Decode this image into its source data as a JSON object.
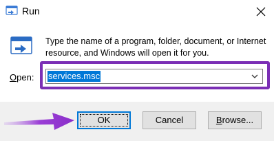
{
  "window": {
    "title": "Run"
  },
  "content": {
    "description_line1": "Type the name of a program, folder, document, or Internet",
    "description_line2": "resource, and Windows will open it for you."
  },
  "open": {
    "label_acc": "O",
    "label_rest": "pen:",
    "value": "services.msc"
  },
  "buttons": {
    "ok": "OK",
    "cancel": "Cancel",
    "browse_acc": "B",
    "browse_rest": "rowse..."
  },
  "colors": {
    "selection": "#0078d7",
    "highlight_box": "#7b2fb5",
    "annotation_arrow": "#9b3fd6"
  },
  "icons": {
    "title": "run-app-icon",
    "run": "run-window-icon",
    "close": "close-icon",
    "dropdown": "chevron-down-icon",
    "pointer": "purple-arrow"
  }
}
